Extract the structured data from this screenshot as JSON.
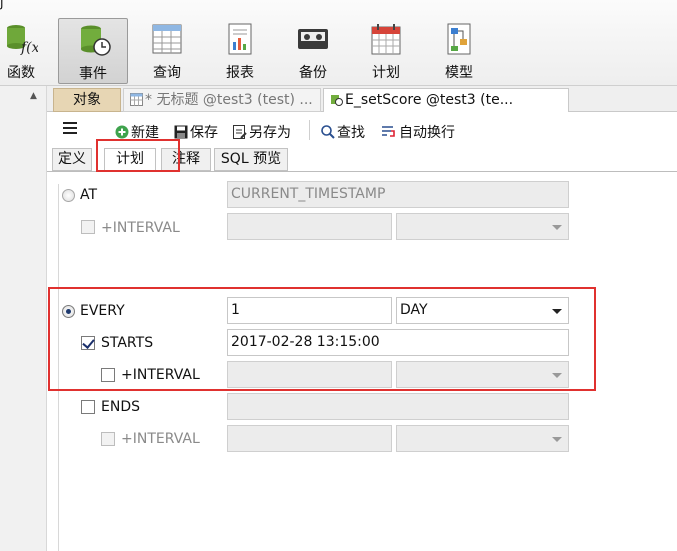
{
  "toolbar": {
    "items": [
      {
        "label": "函数",
        "icon": "function-icon"
      },
      {
        "label": "事件",
        "icon": "event-icon"
      },
      {
        "label": "查询",
        "icon": "query-icon"
      },
      {
        "label": "报表",
        "icon": "report-icon"
      },
      {
        "label": "备份",
        "icon": "backup-icon"
      },
      {
        "label": "计划",
        "icon": "schedule-icon"
      },
      {
        "label": "模型",
        "icon": "model-icon"
      }
    ],
    "top_fragment": "J"
  },
  "tabs": {
    "objects": "对象",
    "untitled": "* 无标题 @test3 (test) ...",
    "event": "E_setScore @test3 (te..."
  },
  "editor": {
    "new": "新建",
    "save": "保存",
    "save_as": "另存为",
    "find": "查找",
    "wrap": "自动换行"
  },
  "subtabs": [
    "定义",
    "计划",
    "注释",
    "SQL 预览"
  ],
  "schedule": {
    "at": {
      "label": "AT",
      "value": "CURRENT_TIMESTAMP",
      "interval_label": "+INTERVAL"
    },
    "every": {
      "label": "EVERY",
      "value": "1",
      "unit": "DAY"
    },
    "starts": {
      "label": "STARTS",
      "value": "2017-02-28 13:15:00",
      "interval_label": "+INTERVAL"
    },
    "ends": {
      "label": "ENDS",
      "interval_label": "+INTERVAL"
    }
  },
  "colors": {
    "accent_red": "#e0312f",
    "objects_tab": "#e7d6b4",
    "check_blue": "#1b2f6b"
  }
}
